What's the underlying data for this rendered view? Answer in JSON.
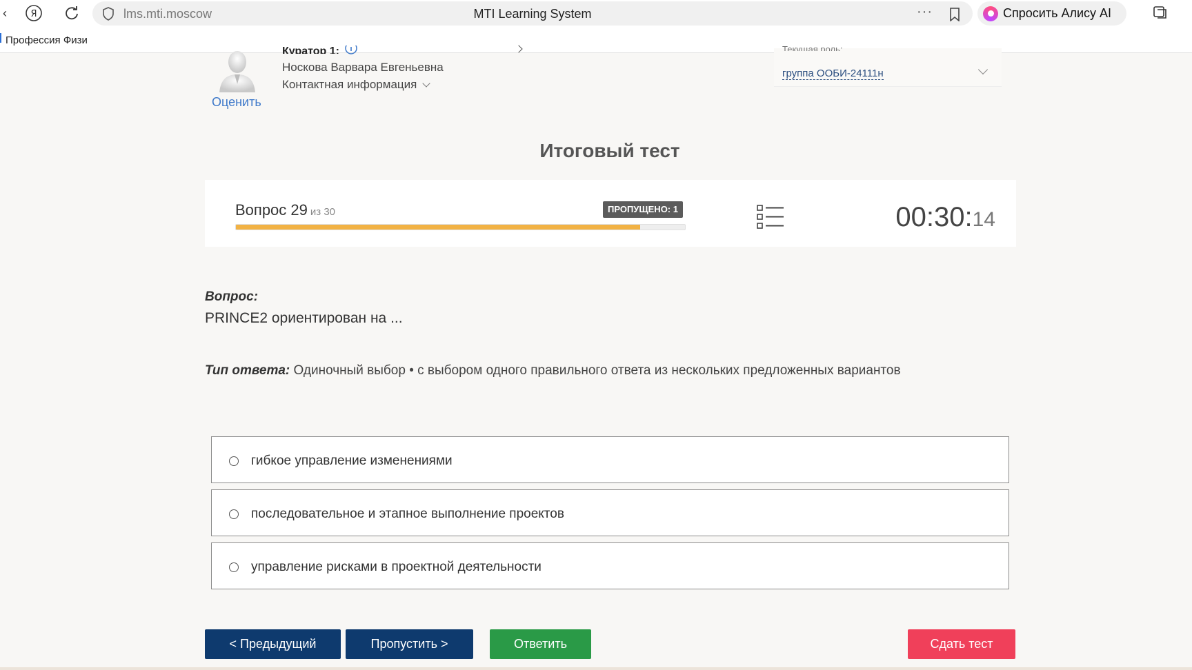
{
  "browser": {
    "url": "lms.mti.moscow",
    "tab_title": "MTI Learning System",
    "alice_label": "Спросить Алису AI",
    "bookmark": "Профессия Физи"
  },
  "curator": {
    "label": "Куратор 1:",
    "name": "Носкова Варвара Евгеньевна",
    "contact": "Контактная информация",
    "rate": "Оценить"
  },
  "role": {
    "label": "Текущая роль:",
    "value": "группа ООБИ-24111н"
  },
  "page_title": "Итоговый тест",
  "progress": {
    "question_label": "Вопрос 29",
    "of_label": "из 30",
    "skipped": "ПРОПУЩЕНО: 1",
    "fraction": 0.9,
    "timer_main": "00:30:",
    "timer_sec": "14"
  },
  "question": {
    "label": "Вопрос:",
    "text": "PRINCE2 ориентирован на ...",
    "type_label": "Тип ответа:",
    "type_value": " Одиночный выбор • с выбором одного правильного ответа из нескольких предложенных вариантов"
  },
  "options": [
    "гибкое управление изменениями",
    "последовательное и этапное выполнение проектов",
    "управление рисками в проектной деятельности"
  ],
  "buttons": {
    "prev": "< Предыдущий",
    "skip": "Пропустить >",
    "answer": "Ответить",
    "submit": "Сдать тест"
  },
  "colors": {
    "navy": "#0e3a6e",
    "green": "#2a9a47",
    "red": "#f0405a",
    "progress": "#f2b244"
  }
}
